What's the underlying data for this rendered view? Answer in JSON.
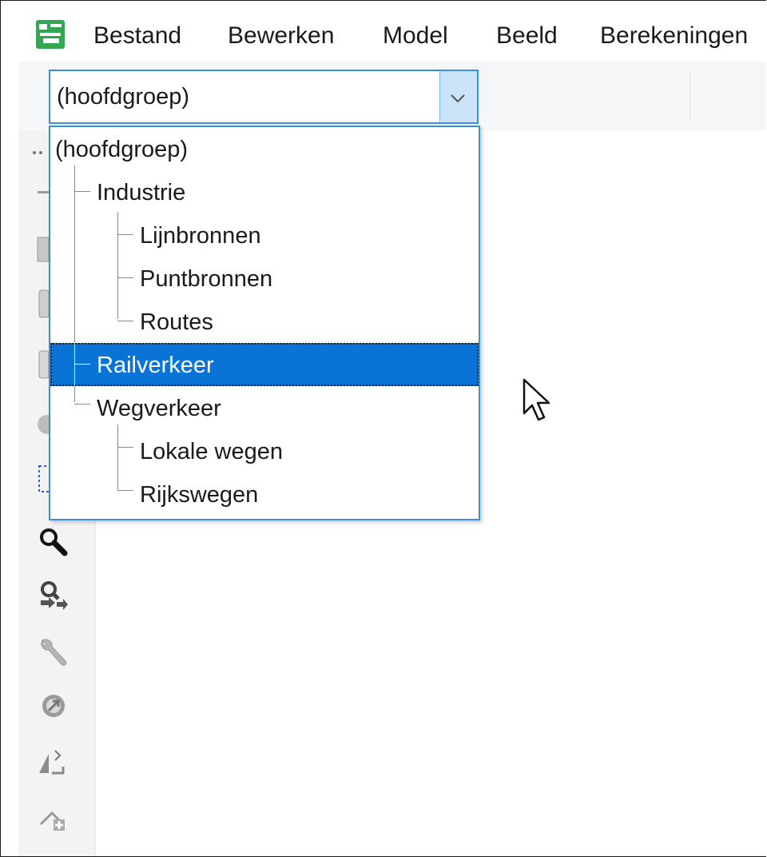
{
  "menu": {
    "items": [
      {
        "label": "Bestand"
      },
      {
        "label": "Bewerken"
      },
      {
        "label": "Model"
      },
      {
        "label": "Beeld"
      },
      {
        "label": "Berekeningen"
      }
    ]
  },
  "group_selector": {
    "value": "(hoofdgroep)",
    "options": [
      {
        "label": "(hoofdgroep)"
      },
      {
        "label": "Industrie"
      },
      {
        "label": "Lijnbronnen"
      },
      {
        "label": "Puntbronnen"
      },
      {
        "label": "Routes"
      },
      {
        "label": "Railverkeer"
      },
      {
        "label": "Wegverkeer"
      },
      {
        "label": "Lokale wegen"
      },
      {
        "label": "Rijkswegen"
      }
    ],
    "selected": "Railverkeer"
  },
  "left_toolbar": {
    "icons": [
      "zoom-icon",
      "zoom-pan-icon",
      "wrench-icon",
      "circle-arrow-icon",
      "edit-line-icon",
      "add-point-icon"
    ]
  },
  "colors": {
    "accent": "#0a74d6",
    "app_icon": "#2fa84f",
    "border": "#3c8ee0"
  }
}
